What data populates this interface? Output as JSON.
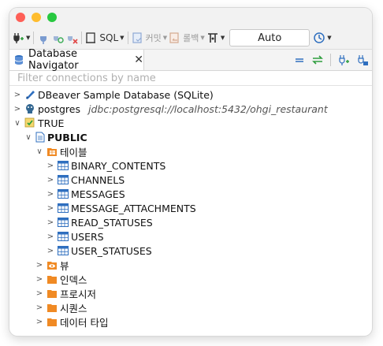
{
  "toolbar": {
    "sql_label": "SQL",
    "commit_label": "커밋",
    "rollback_label": "롤백",
    "transaction_mode": "Auto"
  },
  "tab": {
    "title": "Database Navigator",
    "close_glyph": "✕"
  },
  "filter": {
    "placeholder": "Filter connections by name"
  },
  "tree": {
    "sample_db": "DBeaver Sample Database (SQLite)",
    "postgres": "postgres",
    "postgres_url": "jdbc:postgresql://localhost:5432/ohgi_restaurant",
    "true_conn": "TRUE",
    "schema": "PUBLIC",
    "tables_folder": "테이블",
    "tables": [
      "BINARY_CONTENTS",
      "CHANNELS",
      "MESSAGES",
      "MESSAGE_ATTACHMENTS",
      "READ_STATUSES",
      "USERS",
      "USER_STATUSES"
    ],
    "views_folder": "뷰",
    "indexes_folder": "인덱스",
    "procedures_folder": "프로시저",
    "sequences_folder": "시퀀스",
    "datatypes_folder": "데이터 타입"
  },
  "colors": {
    "table_icon": "#2f6fbf",
    "folder_icon": "#f08a24",
    "traffic_red": "#fe5f57",
    "traffic_yellow": "#febc2e",
    "traffic_green": "#28c840"
  }
}
